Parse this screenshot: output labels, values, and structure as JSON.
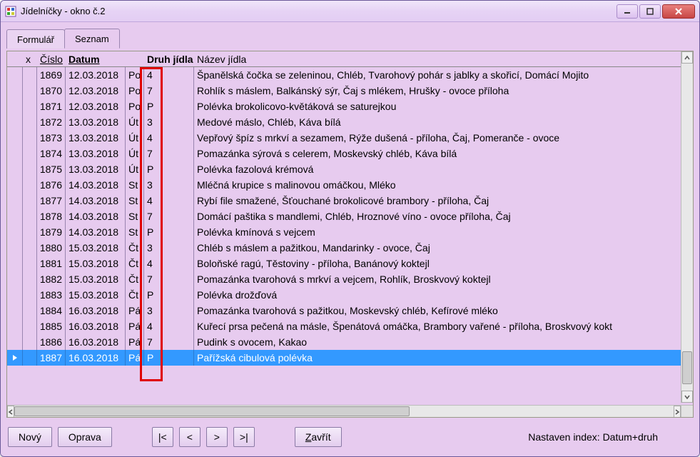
{
  "window": {
    "title": "Jídelníčky - okno č.2"
  },
  "tabs": [
    {
      "id": "formular",
      "label": "Formulář",
      "active": false
    },
    {
      "id": "seznam",
      "label": "Seznam",
      "active": true
    }
  ],
  "grid": {
    "columns": {
      "x": "x",
      "cislo": "Číslo",
      "datum": "Datum",
      "druh": "Druh jídla",
      "nazev": "Název jídla"
    },
    "rows": [
      {
        "cislo": "1869",
        "datum": "12.03.2018",
        "den": "Po",
        "druh": "4",
        "nazev": "Španělská čočka se zeleninou, Chléb, Tvarohový pohár s jablky a skořicí, Domácí Mojito"
      },
      {
        "cislo": "1870",
        "datum": "12.03.2018",
        "den": "Po",
        "druh": "7",
        "nazev": "Rohlík s máslem, Balkánský sýr, Čaj s mlékem, Hrušky - ovoce příloha"
      },
      {
        "cislo": "1871",
        "datum": "12.03.2018",
        "den": "Po",
        "druh": "P",
        "nazev": "Polévka brokolicovo-květáková se saturejkou"
      },
      {
        "cislo": "1872",
        "datum": "13.03.2018",
        "den": "Út",
        "druh": "3",
        "nazev": "Medové máslo, Chléb, Káva bílá"
      },
      {
        "cislo": "1873",
        "datum": "13.03.2018",
        "den": "Út",
        "druh": "4",
        "nazev": "Vepřový špíz s mrkví a sezamem, Rýže dušená - příloha, Čaj, Pomeranče  - ovoce"
      },
      {
        "cislo": "1874",
        "datum": "13.03.2018",
        "den": "Út",
        "druh": "7",
        "nazev": "Pomazánka sýrová s celerem, Moskevský chléb, Káva bílá"
      },
      {
        "cislo": "1875",
        "datum": "13.03.2018",
        "den": "Út",
        "druh": "P",
        "nazev": "Polévka fazolová krémová"
      },
      {
        "cislo": "1876",
        "datum": "14.03.2018",
        "den": "St",
        "druh": "3",
        "nazev": "Mléčná krupice s malinovou omáčkou, Mléko"
      },
      {
        "cislo": "1877",
        "datum": "14.03.2018",
        "den": "St",
        "druh": "4",
        "nazev": "Rybí file smažené, Šťouchané brokolicové brambory - příloha, Čaj"
      },
      {
        "cislo": "1878",
        "datum": "14.03.2018",
        "den": "St",
        "druh": "7",
        "nazev": "Domácí paštika s mandlemi, Chléb, Hroznové víno - ovoce příloha, Čaj"
      },
      {
        "cislo": "1879",
        "datum": "14.03.2018",
        "den": "St",
        "druh": "P",
        "nazev": "Polévka kmínová s vejcem"
      },
      {
        "cislo": "1880",
        "datum": "15.03.2018",
        "den": "Čt",
        "druh": "3",
        "nazev": "Chléb s máslem a pažitkou, Mandarinky - ovoce, Čaj"
      },
      {
        "cislo": "1881",
        "datum": "15.03.2018",
        "den": "Čt",
        "druh": "4",
        "nazev": "Boloňské ragú, Těstoviny - příloha, Banánový koktejl"
      },
      {
        "cislo": "1882",
        "datum": "15.03.2018",
        "den": "Čt",
        "druh": "7",
        "nazev": "Pomazánka tvarohová s mrkví a vejcem, Rohlík, Broskvový koktejl"
      },
      {
        "cislo": "1883",
        "datum": "15.03.2018",
        "den": "Čt",
        "druh": "P",
        "nazev": "Polévka drožďová"
      },
      {
        "cislo": "1884",
        "datum": "16.03.2018",
        "den": "Pá",
        "druh": "3",
        "nazev": "Pomazánka tvarohová s pažitkou, Moskevský chléb, Kefírové mléko"
      },
      {
        "cislo": "1885",
        "datum": "16.03.2018",
        "den": "Pá",
        "druh": "4",
        "nazev": "Kuřecí prsa pečená na másle, Špenátová omáčka, Brambory vařené - příloha, Broskvový kokt"
      },
      {
        "cislo": "1886",
        "datum": "16.03.2018",
        "den": "Pá",
        "druh": "7",
        "nazev": "Pudink s ovocem, Kakao"
      },
      {
        "cislo": "1887",
        "datum": "16.03.2018",
        "den": "Pá",
        "druh": "P",
        "nazev": "Pařížská cibulová polévka",
        "selected": true,
        "marker": true
      }
    ]
  },
  "buttons": {
    "novy": "Nový",
    "oprava": "Oprava",
    "first": "|<",
    "prev": "<",
    "next": ">",
    "last": ">|",
    "zavrit_prefix": "Z",
    "zavrit_rest": "avřít"
  },
  "status": "Nastaven index: Datum+druh"
}
